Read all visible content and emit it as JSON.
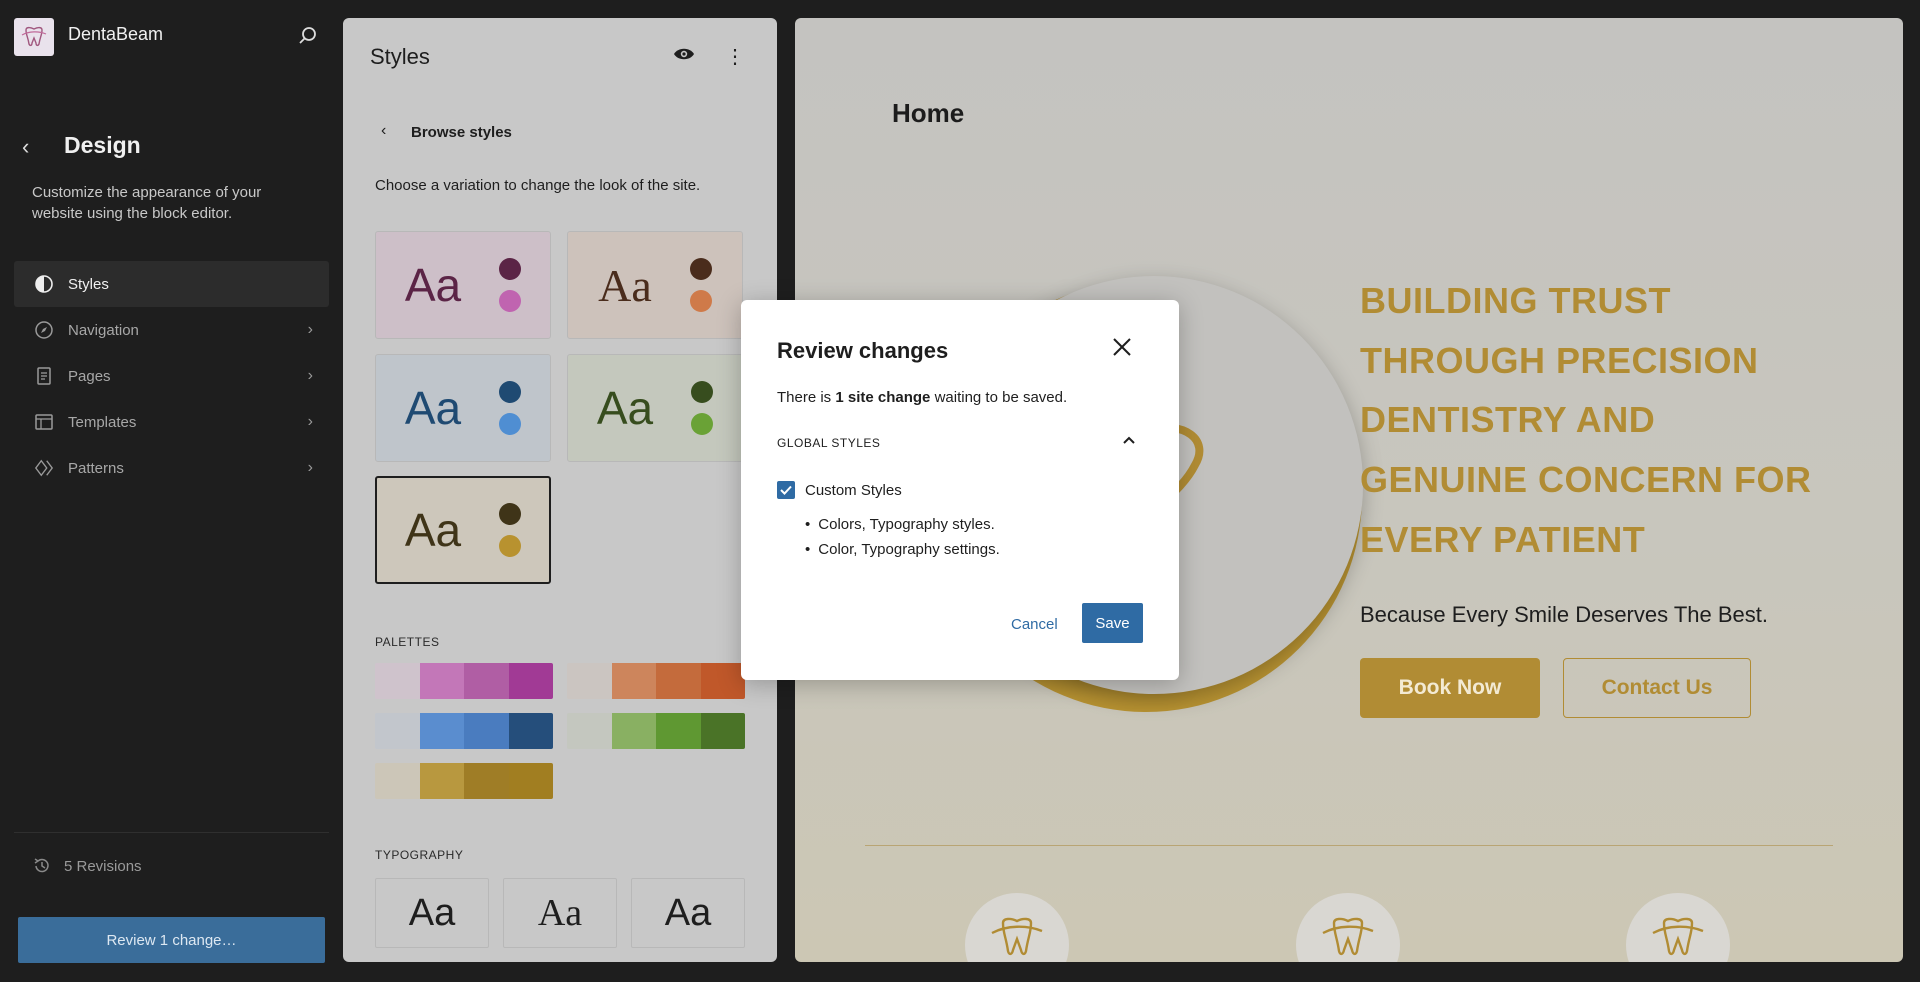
{
  "sidebar": {
    "site_name": "DentaBeam",
    "section_title": "Design",
    "description": "Customize the appearance of your website using the block editor.",
    "items": [
      {
        "label": "Styles",
        "icon": "half-circle-icon",
        "active": true
      },
      {
        "label": "Navigation",
        "icon": "compass-icon"
      },
      {
        "label": "Pages",
        "icon": "page-icon"
      },
      {
        "label": "Templates",
        "icon": "layout-icon"
      },
      {
        "label": "Patterns",
        "icon": "diamond-icon"
      }
    ],
    "revisions": "5 Revisions",
    "review_button": "Review 1 change…"
  },
  "styles_panel": {
    "title": "Styles",
    "browse": "Browse styles",
    "choose_text": "Choose a variation to change the look of the site.",
    "variations": [
      {
        "aa": "Aa",
        "text_color": "#5b2446",
        "bg": "#cdbfc8",
        "dot1": "#5b2446",
        "dot2": "#c064b0"
      },
      {
        "aa": "Aa",
        "text_color": "#4a2c1c",
        "bg": "#cdc2bb",
        "dot1": "#4a2c1c",
        "dot2": "#cf7a49"
      },
      {
        "aa": "Aa",
        "text_color": "#1f4a72",
        "bg": "#bfc5cb",
        "dot1": "#1f4a72",
        "dot2": "#4f8ed2"
      },
      {
        "aa": "Aa",
        "text_color": "#374d1e",
        "bg": "#c4c8bd",
        "dot1": "#374d1e",
        "dot2": "#6aa236"
      },
      {
        "aa": "Aa",
        "text_color": "#3f3418",
        "bg": "#cdc7bb",
        "dot1": "#3f3418",
        "dot2": "#b8922f"
      }
    ],
    "palettes_label": "PALETTES",
    "palettes": [
      [
        "#cfc3cc",
        "#c377b8",
        "#b05ea4",
        "#a13a95"
      ],
      [
        "#cbc5c1",
        "#cd855c",
        "#c46b3c",
        "#c0582a"
      ],
      [
        "#c2c6cc",
        "#5a8dcf",
        "#4a7cbf",
        "#254e7b"
      ],
      [
        "#c4c7bf",
        "#89b062",
        "#5f9832",
        "#4a7327"
      ],
      [
        "#ccc6b8",
        "#b8983f",
        "#9f7d26",
        "#a17e21"
      ]
    ],
    "typography_label": "TYPOGRAPHY",
    "typography": [
      "Aa",
      "Aa",
      "Aa"
    ]
  },
  "canvas": {
    "page_title": "Home",
    "headline": [
      "BUILDING TRUST",
      "THROUGH PRECISION",
      "DENTISTRY AND",
      "GENUINE CONCERN FOR",
      "EVERY PATIENT"
    ],
    "tagline": "Because Every Smile Deserves The Best.",
    "book_button": "Book Now",
    "contact_button": "Contact Us"
  },
  "modal": {
    "title": "Review changes",
    "message_pre": "There is ",
    "message_bold": "1 site change",
    "message_post": " waiting to be saved.",
    "section": "GLOBAL STYLES",
    "checkbox_label": "Custom Styles",
    "checked": true,
    "list": [
      "Colors, Typography styles.",
      "Color, Typography settings."
    ],
    "cancel": "Cancel",
    "save": "Save"
  }
}
